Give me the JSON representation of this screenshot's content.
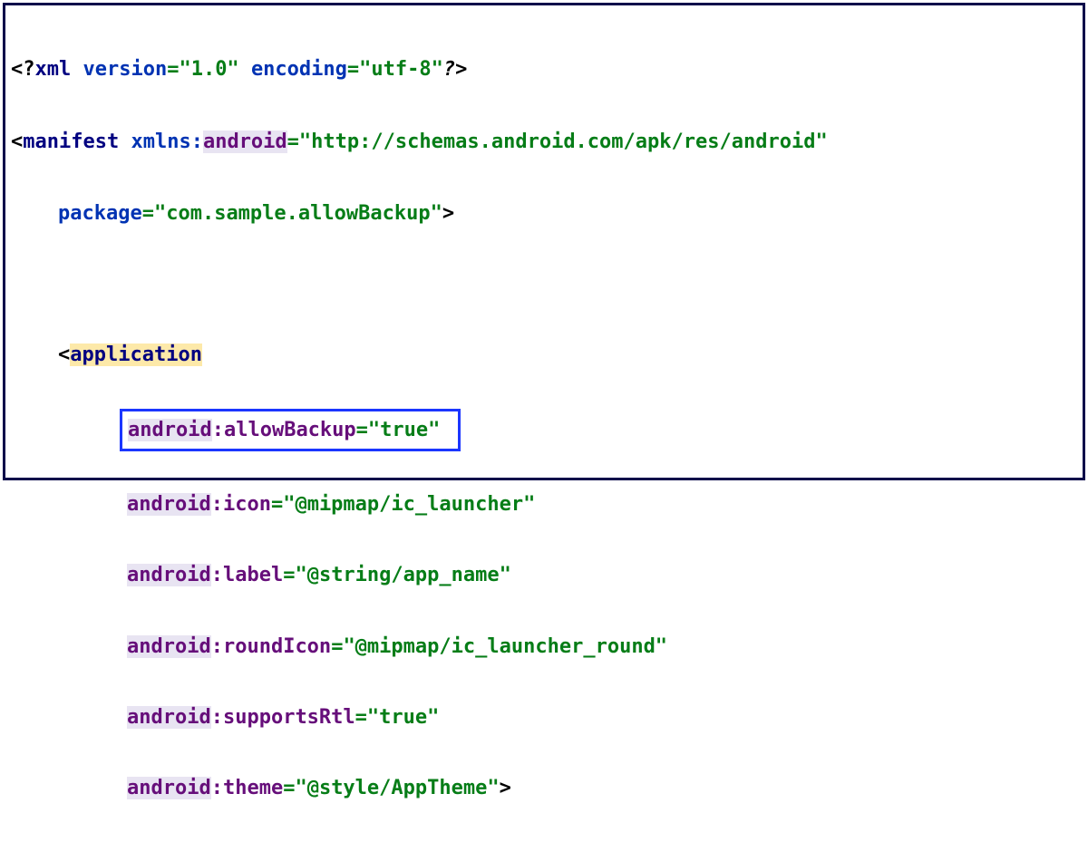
{
  "xml_decl": {
    "version_attr": "version",
    "version_val": "\"1.0\"",
    "encoding_attr": "encoding",
    "encoding_val": "\"utf-8\""
  },
  "manifest": {
    "tag": "manifest",
    "xmlns_prefix": "xmlns",
    "xmlns_local": "android",
    "xmlns_val": "\"http://schemas.android.com/apk/res/android\"",
    "package_attr": "package",
    "package_val": "\"com.sample.allowBackup\""
  },
  "application": {
    "tag": "application",
    "attrs": {
      "allowBackup": {
        "ns": "android",
        "name": "allowBackup",
        "val": "\"true\""
      },
      "icon": {
        "ns": "android",
        "name": "icon",
        "val": "\"@mipmap/ic_launcher\""
      },
      "label": {
        "ns": "android",
        "name": "label",
        "val": "\"@string/app_name\""
      },
      "roundIcon": {
        "ns": "android",
        "name": "roundIcon",
        "val": "\"@mipmap/ic_launcher_round\""
      },
      "supportsRtl": {
        "ns": "android",
        "name": "supportsRtl",
        "val": "\"true\""
      },
      "theme": {
        "ns": "android",
        "name": "theme",
        "val": "\"@style/AppTheme\""
      }
    }
  }
}
